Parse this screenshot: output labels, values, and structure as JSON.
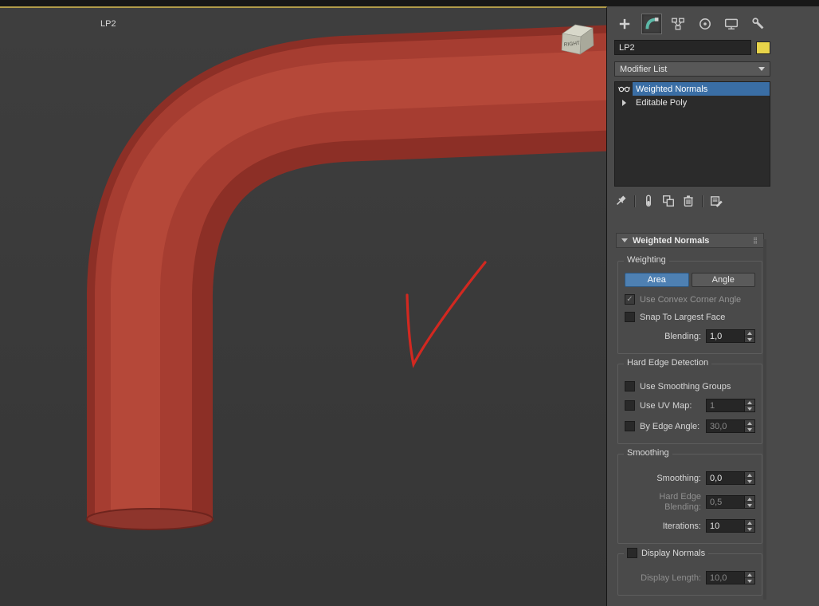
{
  "colors": {
    "accent_blue": "#4e80b2",
    "selection_blue": "#3a6ea5",
    "object_color_swatch": "#e8d44a",
    "active_viewport_border": "#b29c4a",
    "pipe_red": "#a63d31",
    "annotation_red": "#d22820"
  },
  "icons": {
    "check": "✓"
  },
  "viewport": {
    "object_label": "LP2",
    "viewcube_face_label": "RIGHT"
  },
  "command_panel": {
    "object_name": "LP2",
    "modifier_list_label": "Modifier List",
    "modifier_stack": [
      {
        "label": "Weighted Normals"
      },
      {
        "label": "Editable Poly"
      }
    ],
    "rollout": {
      "title": "Weighted Normals",
      "weighting": {
        "title": "Weighting",
        "area_button": "Area",
        "angle_button": "Angle",
        "use_convex_corner_angle": "Use Convex Corner Angle",
        "snap_to_largest_face": "Snap To Largest Face",
        "blending_label": "Blending:",
        "blending_value": "1,0"
      },
      "hard_edge_detection": {
        "title": "Hard Edge Detection",
        "use_smoothing_groups": "Use Smoothing Groups",
        "use_uv_map_label": "Use UV Map:",
        "use_uv_map_value": "1",
        "by_edge_angle_label": "By Edge Angle:",
        "by_edge_angle_value": "30,0"
      },
      "smoothing": {
        "title": "Smoothing",
        "smoothing_label": "Smoothing:",
        "smoothing_value": "0,0",
        "hard_edge_blending_line1": "Hard Edge",
        "hard_edge_blending_line2": "Blending:",
        "hard_edge_blending_value": "0,5",
        "iterations_label": "Iterations:",
        "iterations_value": "10"
      },
      "display_normals": {
        "title": "Display Normals",
        "display_length_label": "Display Length:",
        "display_length_value": "10,0"
      }
    }
  }
}
